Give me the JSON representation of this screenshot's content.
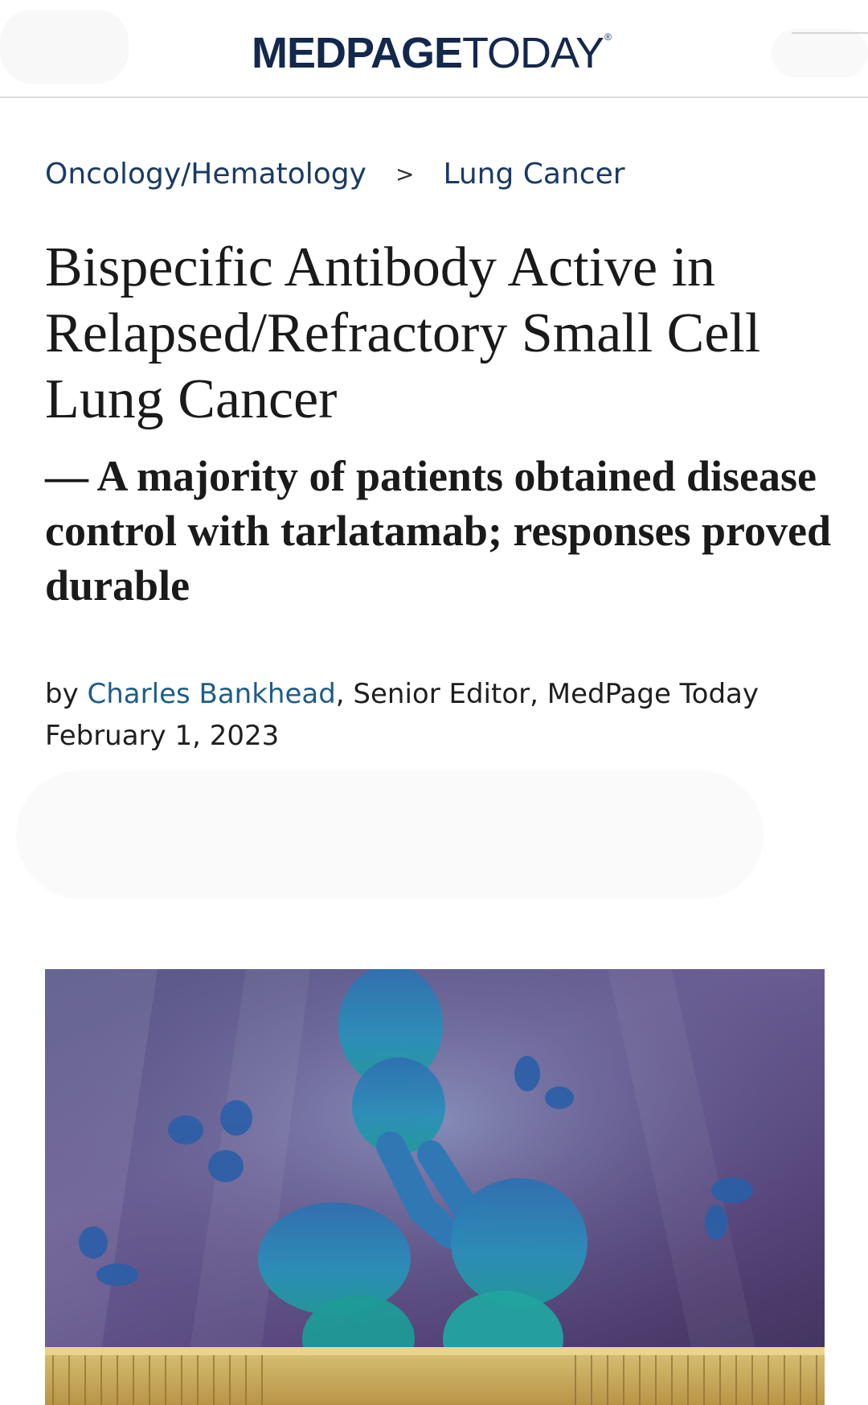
{
  "header": {
    "logo": {
      "bold_text": "MEDPAGE",
      "light_text": "TODAY",
      "registered_mark": "®"
    }
  },
  "breadcrumb": {
    "items": [
      "Oncology/Hematology",
      "Lung Cancer"
    ],
    "separator": ">"
  },
  "article": {
    "title": "Bispecific Antibody Active in Relapsed/Refractory Small Cell Lung Cancer",
    "subtitle": "— A majority of patients obtained disease control with tarlatamab; responses proved durable",
    "byline": {
      "prefix": "by ",
      "author": "Charles Bankhead",
      "role": ", Senior Editor, MedPage Today"
    },
    "date": "February 1, 2023"
  },
  "hero_image": {
    "icon": "antibody-illustration-icon"
  },
  "colors": {
    "brand_navy": "#13284c",
    "link_blue": "#1c5d8c",
    "breadcrumb_blue": "#1a3a66"
  }
}
